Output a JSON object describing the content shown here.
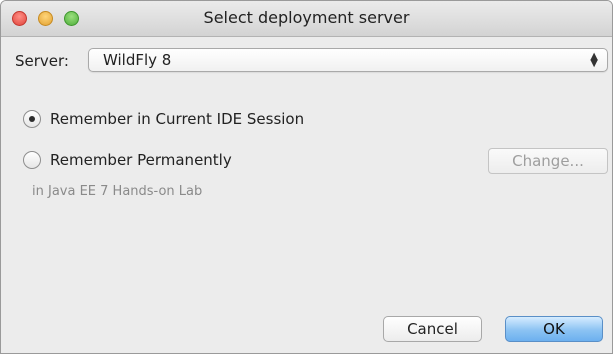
{
  "window": {
    "title": "Select deployment server"
  },
  "server": {
    "label": "Server:",
    "selected": "WildFly 8",
    "arrows_up": "▲",
    "arrows_down": "▼"
  },
  "options": {
    "session_label": "Remember in Current IDE Session",
    "session_checked": true,
    "permanent_label": "Remember Permanently",
    "permanent_checked": false,
    "change_label": "Change...",
    "hint": "in Java EE 7 Hands-on Lab"
  },
  "buttons": {
    "cancel_label": "Cancel",
    "ok_label": "OK"
  },
  "colors": {
    "ok_accent": "#8cc3f3",
    "close": "#e0443b",
    "minimize": "#e2a232",
    "zoom": "#4fae3a"
  }
}
